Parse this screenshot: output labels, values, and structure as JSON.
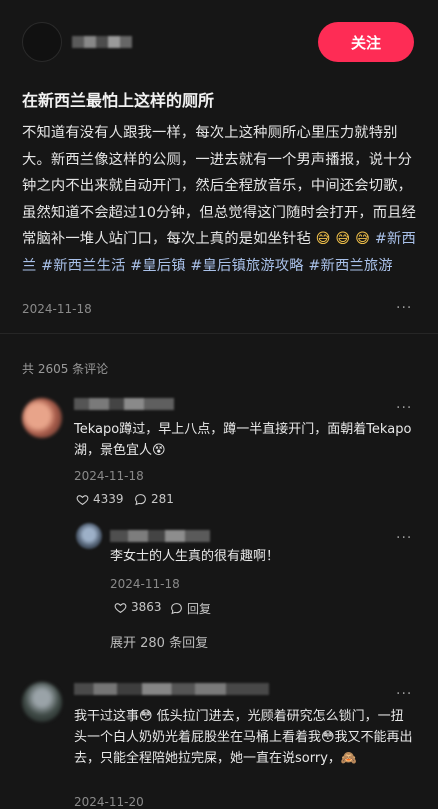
{
  "header": {
    "follow_label": "关注"
  },
  "post": {
    "title": "在新西兰最怕上这样的厕所",
    "body_text": "不知道有没有人跟我一样，每次上这种厕所心里压力就特别大。新西兰像这样的公厕，一进去就有一个男声播报，说十分钟之内不出来就自动开门，然后全程放音乐，中间还会切歌，虽然知道不会超过10分钟，但总觉得这门随时会打开，而且经常脑补一堆人站门口，每次上真的是如坐针毡",
    "emojis": "😅 😅 😅",
    "tags": [
      "#新西兰",
      "#新西兰生活",
      "#皇后镇",
      "#皇后镇旅游攻略",
      "#新西兰旅游"
    ],
    "date": "2024-11-18"
  },
  "comments_header": "共 2605 条评论",
  "comments": [
    {
      "text": "Tekapo蹲过，早上八点，蹲一半直接开门，面朝着Tekapo湖，景色宜人😵",
      "date": "2024-11-18",
      "likes": "4339",
      "replies": "281"
    },
    {
      "text": "李女士的人生真的很有趣啊！",
      "date": "2024-11-18",
      "likes": "3863",
      "reply_label": "回复"
    },
    {
      "text": "我干过这事😳 低头拉门进去，光顾着研究怎么锁门，一扭头一个白人奶奶光着屁股坐在马桶上看着我😳我又不能再出去，只能全程陪她拉完屎，她一直在说sorry，🙈",
      "date": "2024-11-20"
    }
  ],
  "expand_label": "展开 280 条回复",
  "more_glyph": "···"
}
